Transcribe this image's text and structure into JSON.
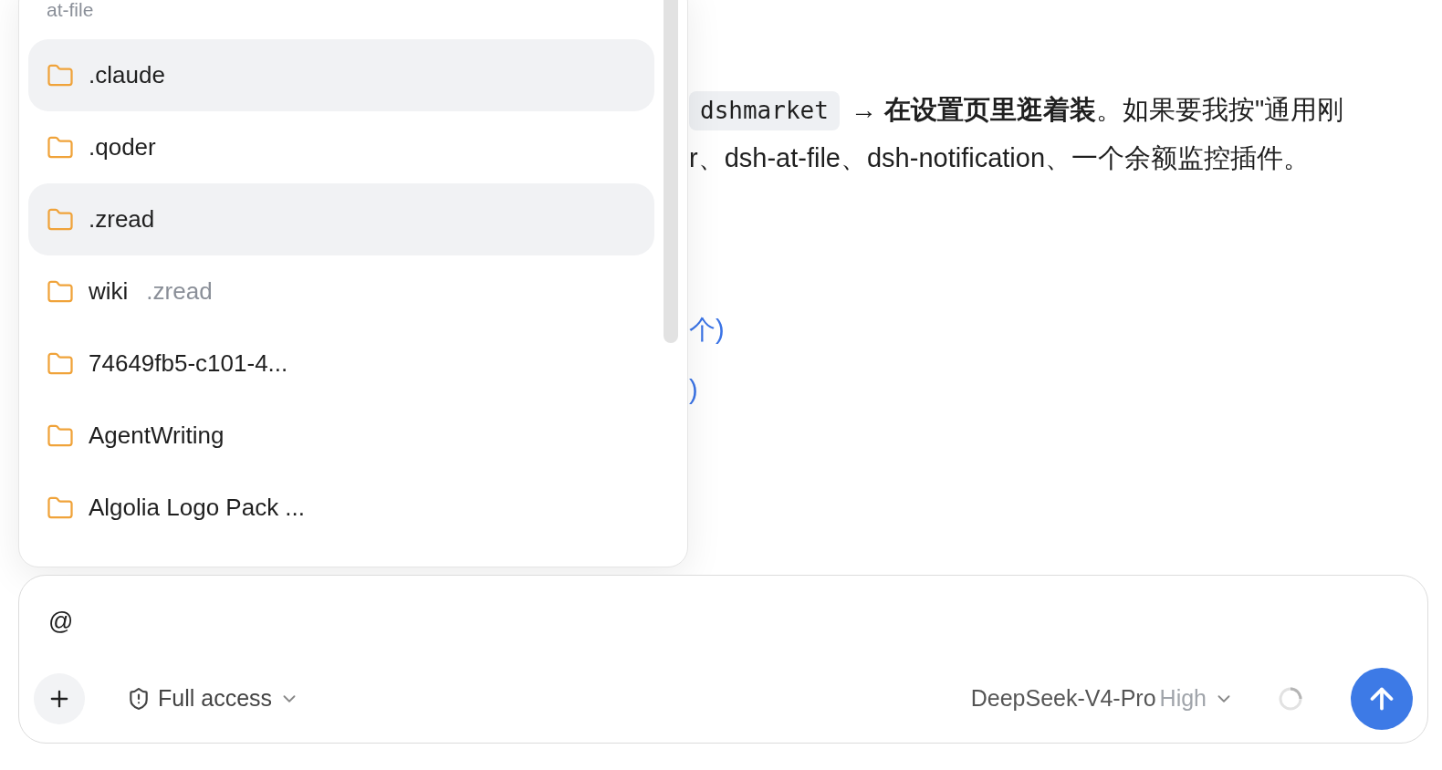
{
  "conversation": {
    "line_1": {
      "code": "dshmarket",
      "text": "→ **在设置页里逛着装**。如果要我按\"通用刚"
    },
    "line_2": "r、dsh-at-file、dsh-notification、一个余额监控插件。",
    "links": [
      "个)",
      ")"
    ]
  },
  "file_popup": {
    "header": "at-file",
    "items": [
      {
        "name": ".claude",
        "selected": true
      },
      {
        "name": ".qoder",
        "selected": false
      },
      {
        "name": ".zread",
        "selected": true
      },
      {
        "name": "wiki",
        "path": ".zread",
        "selected": false
      },
      {
        "name": "74649fb5-c101-4...",
        "selected": false
      },
      {
        "name": "AgentWriting",
        "selected": false
      },
      {
        "name": "Algolia Logo Pack ...",
        "selected": false
      }
    ]
  },
  "composer": {
    "value": "@",
    "access": "Full access",
    "model": "DeepSeek-V4-Pro",
    "effort": "High"
  }
}
